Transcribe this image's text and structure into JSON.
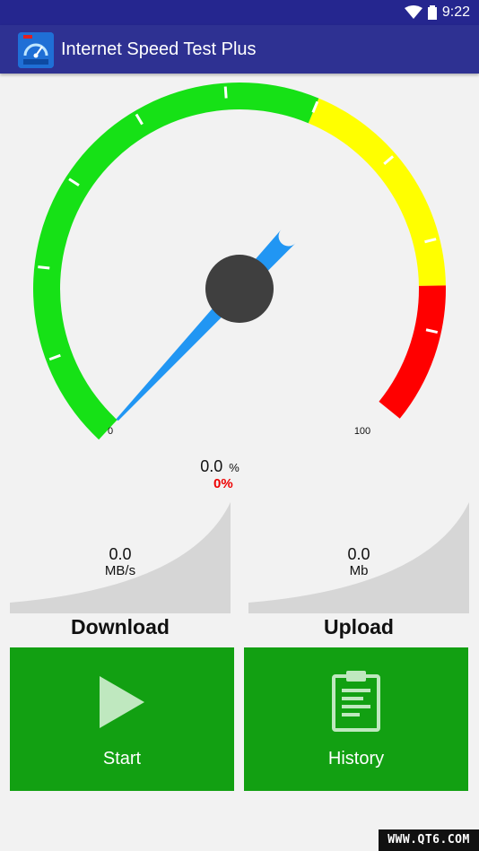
{
  "status_bar": {
    "time": "9:22",
    "wifi_icon": "wifi-icon",
    "battery_icon": "battery-icon"
  },
  "app_bar": {
    "title": "Internet Speed Test Plus",
    "icon": "speedometer-app-icon"
  },
  "gauge": {
    "min_label": "0",
    "max_label": "100",
    "needle_value": 0,
    "zones": [
      {
        "color": "#16e116",
        "from": 0,
        "to": 60
      },
      {
        "color": "#ffff00",
        "from": 60,
        "to": 85
      },
      {
        "color": "#ff0000",
        "from": 85,
        "to": 100
      }
    ],
    "needle_color": "#2196f3",
    "hub_color": "#3f3f3f"
  },
  "readout": {
    "value": "0.0",
    "unit": "%",
    "percent": "0%"
  },
  "download": {
    "value": "0.0",
    "unit": "MB/s",
    "label": "Download"
  },
  "upload": {
    "value": "0.0",
    "unit": "Mb",
    "label": "Upload"
  },
  "buttons": {
    "start": {
      "label": "Start",
      "icon": "play-icon"
    },
    "history": {
      "label": "History",
      "icon": "clipboard-icon"
    }
  },
  "watermark": "WWW.QT6.COM"
}
